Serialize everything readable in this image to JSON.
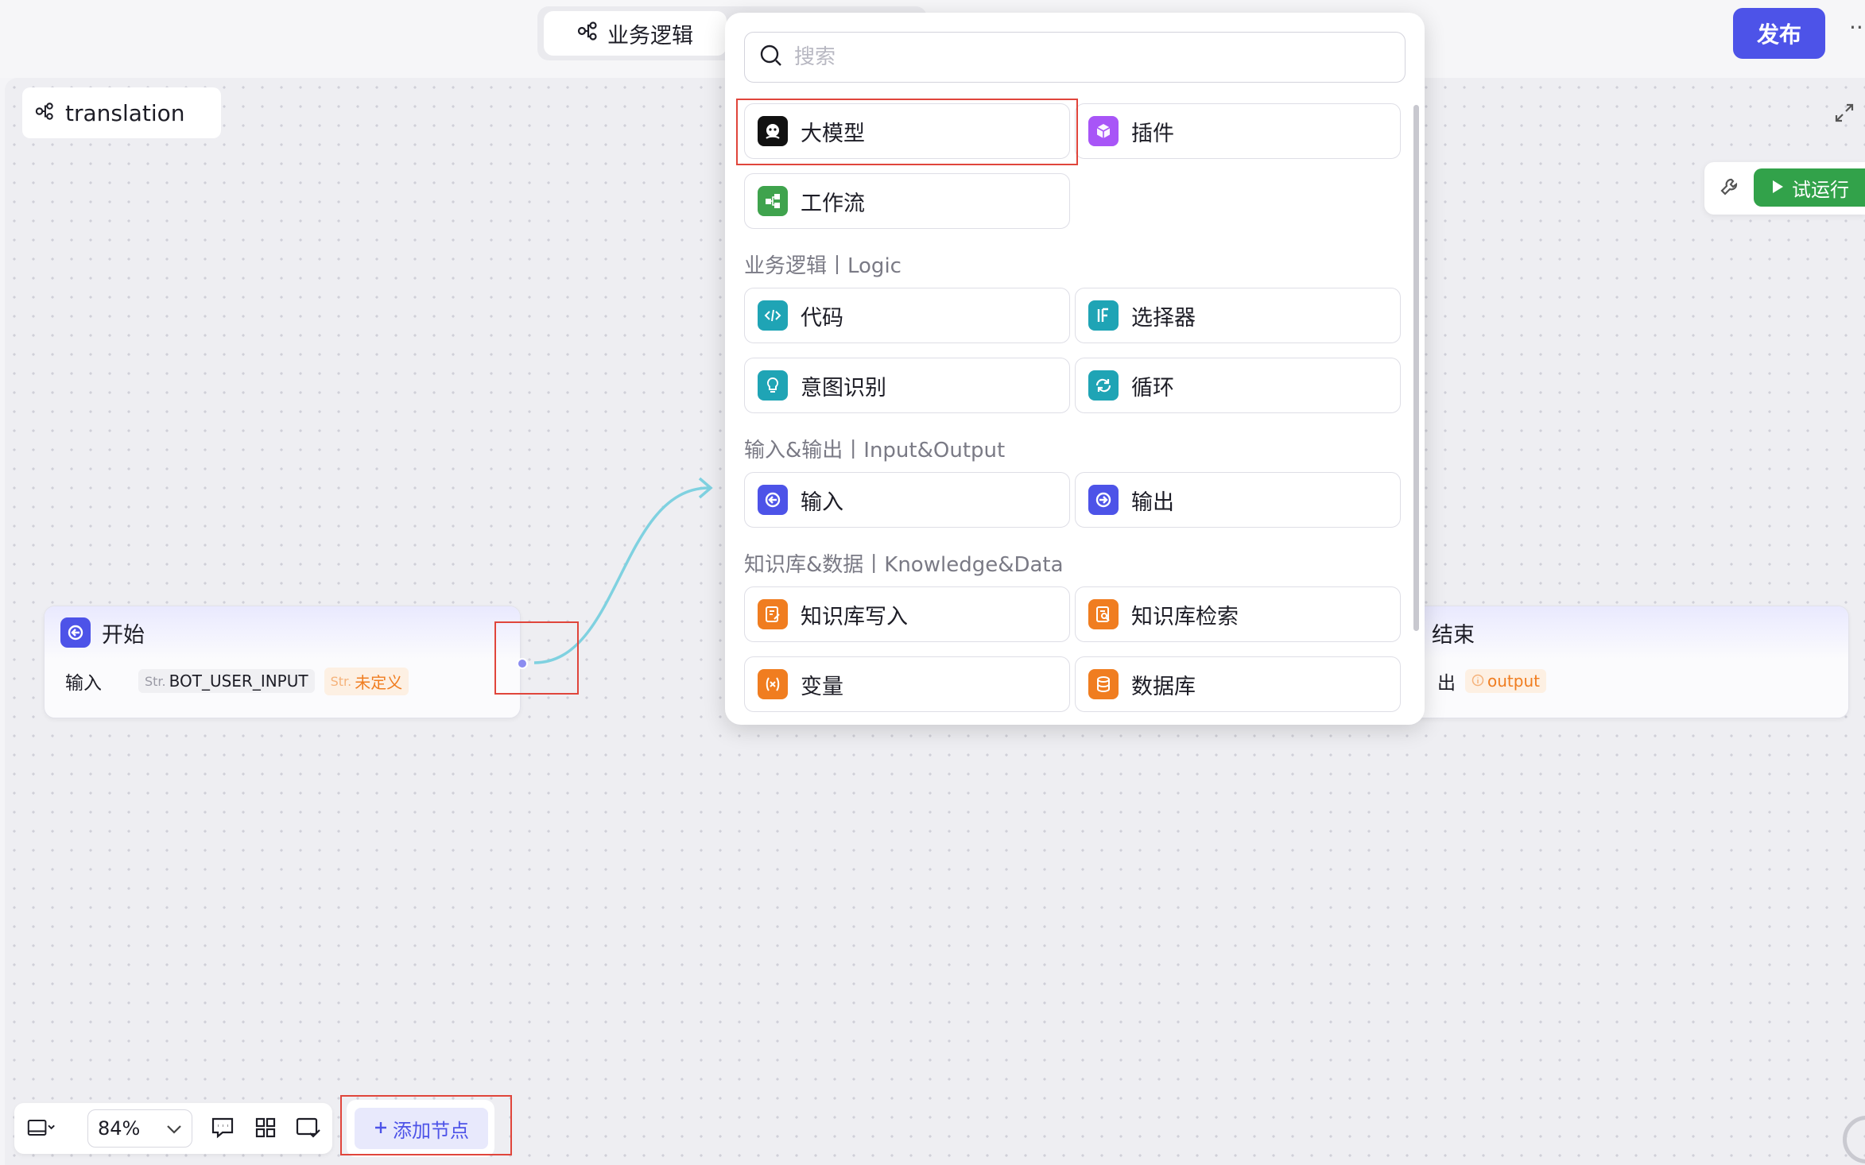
{
  "header": {
    "tab_active_label": "业务逻辑",
    "publish_label": "发布",
    "more_label": "···"
  },
  "workflow": {
    "name": "translation"
  },
  "toolbar_right": {
    "run_label": "试运行"
  },
  "nodes": {
    "start": {
      "title": "开始",
      "row_label": "输入",
      "param_type": "Str.",
      "param_name": "BOT_USER_INPUT",
      "undefined_type": "Str.",
      "undefined_label": "未定义"
    },
    "end": {
      "title": "结束",
      "row_label_partial": "出",
      "output_label": "output"
    }
  },
  "node_picker": {
    "search_placeholder": "搜索",
    "top_items": [
      {
        "label": "大模型",
        "icon": "llm-icon",
        "color": "#111111"
      },
      {
        "label": "插件",
        "icon": "plugin-icon",
        "color": "#a855f7"
      },
      {
        "label": "工作流",
        "icon": "workflow-icon",
        "color": "#3fa34d"
      }
    ],
    "sections": [
      {
        "title": "业务逻辑丨Logic",
        "items": [
          {
            "label": "代码",
            "icon": "code-icon",
            "color": "#1fa4b5"
          },
          {
            "label": "选择器",
            "icon": "if-icon",
            "color": "#1fa4b5"
          },
          {
            "label": "意图识别",
            "icon": "intent-icon",
            "color": "#1fa4b5"
          },
          {
            "label": "循环",
            "icon": "loop-icon",
            "color": "#1fa4b5"
          }
        ]
      },
      {
        "title": "输入&输出丨Input&Output",
        "items": [
          {
            "label": "输入",
            "icon": "input-icon",
            "color": "#4d53e8"
          },
          {
            "label": "输出",
            "icon": "output-icon",
            "color": "#4d53e8"
          }
        ]
      },
      {
        "title": "知识库&数据丨Knowledge&Data",
        "items": [
          {
            "label": "知识库写入",
            "icon": "knowledge-write-icon",
            "color": "#f07d20"
          },
          {
            "label": "知识库检索",
            "icon": "knowledge-search-icon",
            "color": "#f07d20"
          },
          {
            "label": "变量",
            "icon": "variable-icon",
            "color": "#f07d20"
          },
          {
            "label": "数据库",
            "icon": "database-icon",
            "color": "#f07d20"
          }
        ]
      }
    ]
  },
  "bottom_toolbar": {
    "zoom": "84%",
    "add_node_label": "添加节点"
  },
  "colors": {
    "accent": "#4d53e8",
    "run_green": "#32a24a",
    "highlight_red": "#e0453b",
    "connector": "#7fd1e0"
  }
}
